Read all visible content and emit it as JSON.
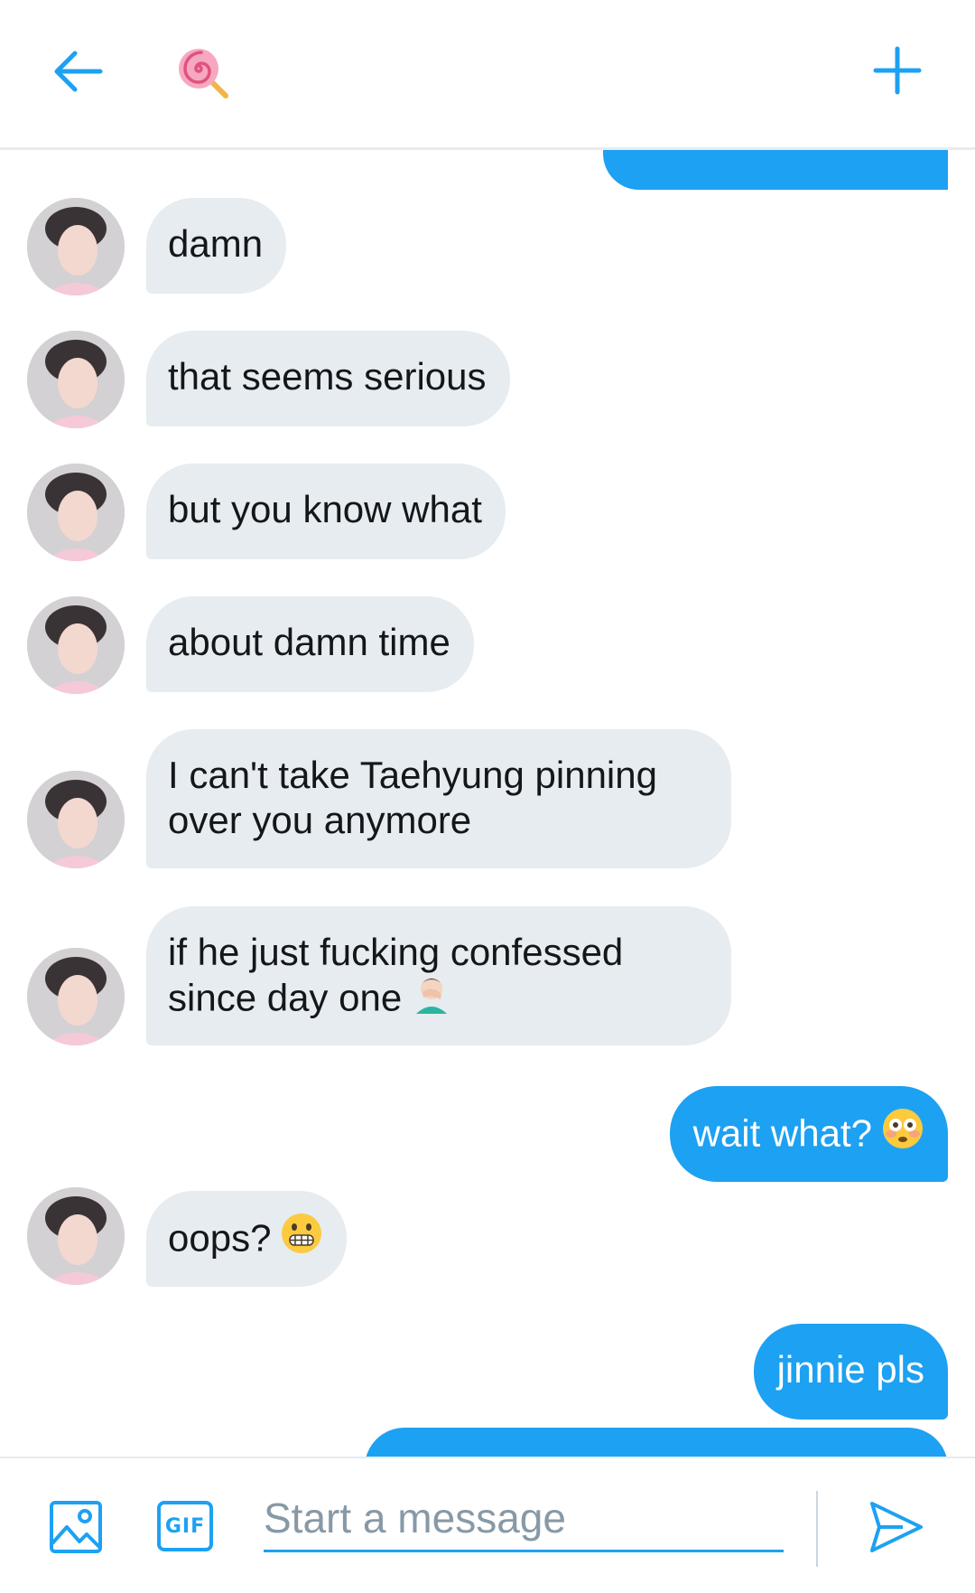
{
  "header": {
    "back_icon": "arrow-left-icon",
    "avatar_emoji": "🍭",
    "new_icon": "plus-icon",
    "accent": "#1da1f2"
  },
  "messages": [
    {
      "from": "them",
      "text": "damn"
    },
    {
      "from": "them",
      "text": "that seems serious"
    },
    {
      "from": "them",
      "text": "but you know what"
    },
    {
      "from": "them",
      "text": "about damn time"
    },
    {
      "from": "them",
      "text": "I can't take Taehyung pinning\nover you anymore"
    },
    {
      "from": "them",
      "text": "if he just fucking confessed\nsince day one",
      "emoji": "🤦🏻‍♂️"
    },
    {
      "from": "me",
      "text": "wait what?",
      "emoji": "😳"
    },
    {
      "from": "them",
      "text": "oops?",
      "emoji": "😬"
    },
    {
      "from": "me",
      "text": "jinnie pls"
    }
  ],
  "composer": {
    "placeholder": "Start a message",
    "gif_label": "GIF",
    "media_icon": "image-icon",
    "send_icon": "send-icon"
  }
}
